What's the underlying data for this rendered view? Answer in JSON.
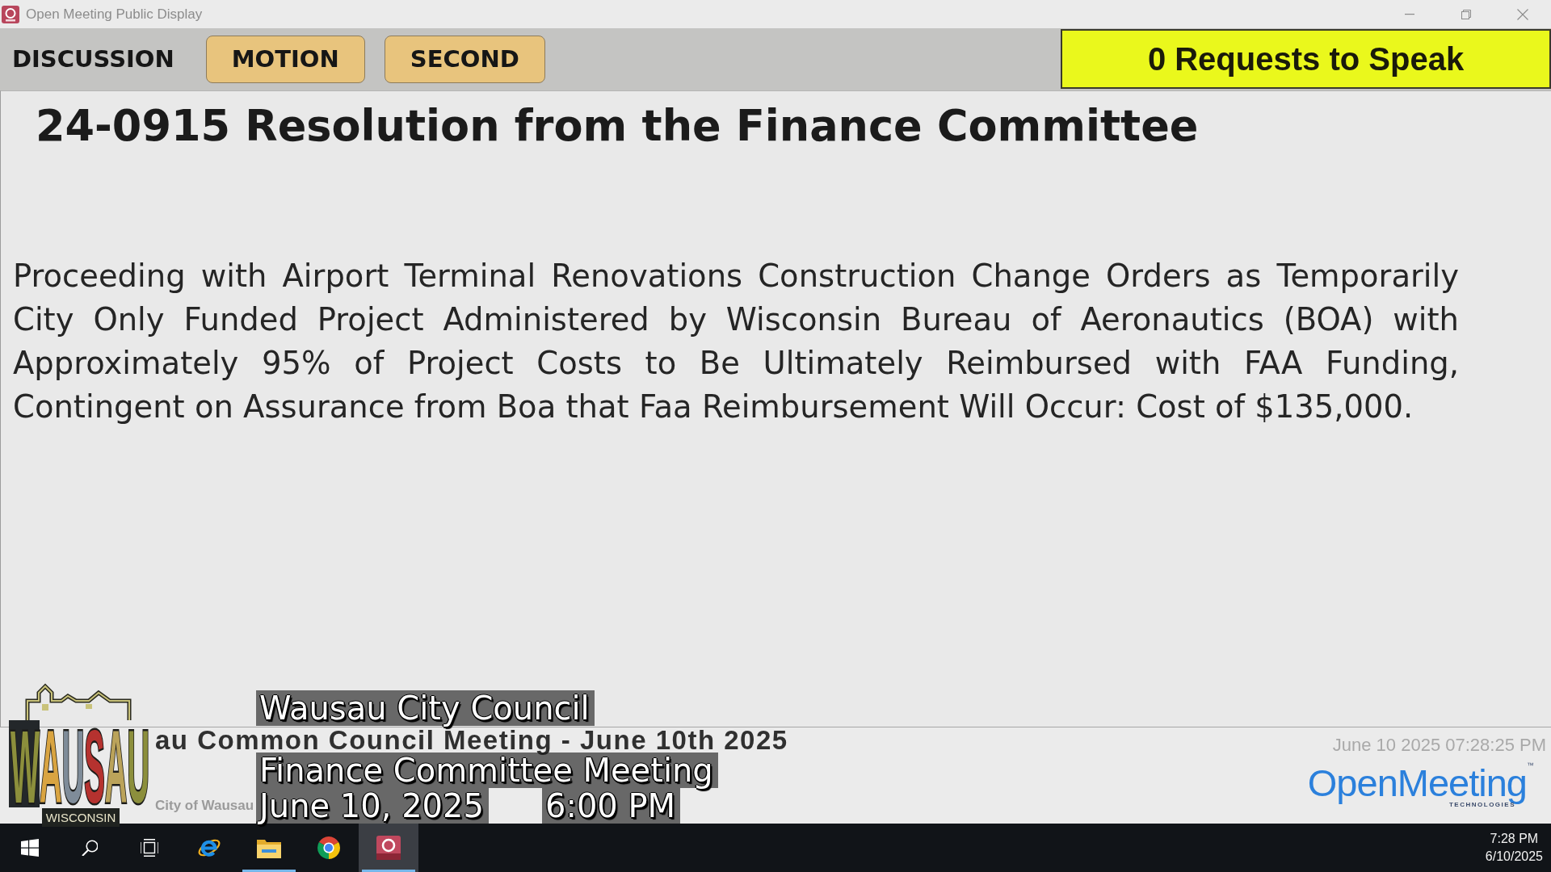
{
  "window": {
    "title": "Open Meeting Public Display"
  },
  "toolbar": {
    "stages": [
      {
        "label": "DISCUSSION",
        "on": false
      },
      {
        "label": "MOTION",
        "on": true
      },
      {
        "label": "SECOND",
        "on": true
      }
    ],
    "requests": "0 Requests to Speak"
  },
  "agenda_item": {
    "title": "24-0915 Resolution from the Finance Committee",
    "description": "Proceeding with Airport Terminal Renovations Construction Change Orders as Temporarily City Only Funded Project Administered by Wisconsin Bureau of Aeronautics (BOA) with Approximately 95% of Project Costs to Be Ultimately Reimbursed with FAA Funding, Contingent on Assurance from Boa that Faa Reimbursement Will Occur: Cost of $135,000."
  },
  "footer": {
    "meeting_title": "au Common Council Meeting - June 10th 2025",
    "organization": "City of Wausau",
    "timestamp": "June 10 2025 07:28:25 PM",
    "vendor_logo": {
      "name": "OpenMeeting",
      "mark": "™",
      "tagline": "TECHNOLOGIES"
    }
  },
  "broadcast_overlay": {
    "logo": {
      "name": "WAUSAU",
      "state": "WISCONSIN"
    },
    "caption_lines": [
      "Wausau City Council",
      "Finance Committee Meeting"
    ],
    "date": "June 10, 2025",
    "time": "6:00 PM"
  },
  "taskbar": {
    "buttons": [
      {
        "kind": "start"
      },
      {
        "kind": "search"
      },
      {
        "kind": "task-view"
      }
    ],
    "apps": [
      {
        "kind": "e-browser",
        "running": false,
        "selected": false
      },
      {
        "kind": "folder",
        "running": true,
        "selected": false
      },
      {
        "kind": "ring-browser",
        "running": false,
        "selected": false
      },
      {
        "kind": "meeting-app",
        "running": true,
        "selected": true
      }
    ],
    "clock": {
      "time": "7:28 PM",
      "date": "6/10/2025"
    }
  }
}
